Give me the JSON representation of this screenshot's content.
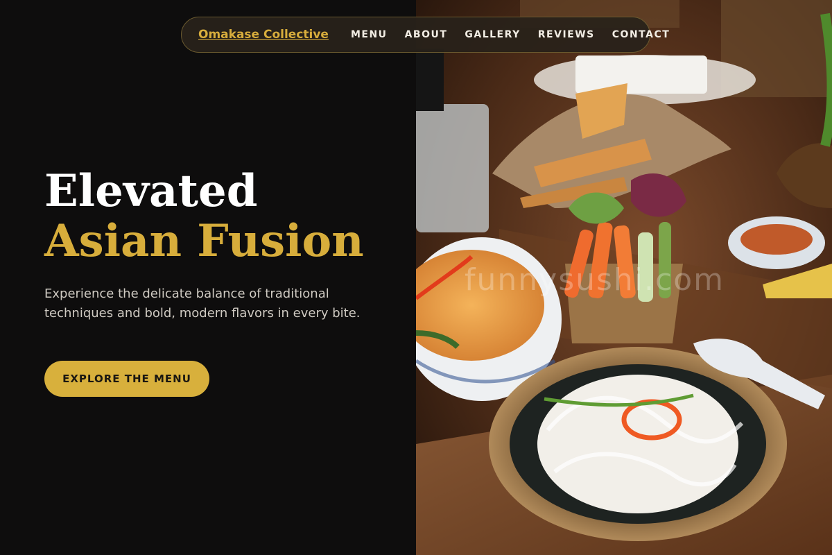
{
  "nav": {
    "brand": "Omakase Collective",
    "links": [
      {
        "label": "MENU"
      },
      {
        "label": "ABOUT"
      },
      {
        "label": "GALLERY"
      },
      {
        "label": "REVIEWS"
      },
      {
        "label": "CONTACT"
      }
    ]
  },
  "hero": {
    "headline_line1": "Elevated",
    "headline_line2": "Asian Fusion",
    "subtext": "Experience the delicate balance of traditional techniques and bold, modern flavors in every bite.",
    "cta_label": "EXPLORE THE MENU"
  },
  "image": {
    "watermark": "funnysushi.com"
  },
  "colors": {
    "background": "#0e0d0d",
    "accent": "#d8b03c",
    "text": "#ffffff"
  }
}
